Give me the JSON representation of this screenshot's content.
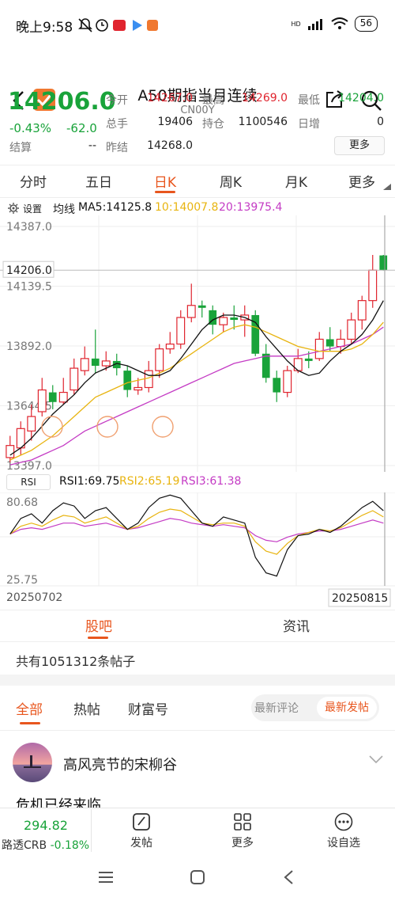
{
  "status_bar": {
    "time": "晚上9:58",
    "battery": "56",
    "hd": "HD"
  },
  "nav": {
    "title": "A50期指当月连续",
    "subtitle": "CN00Y"
  },
  "quote": {
    "price": "14206.0",
    "change_pct": "-0.43%",
    "change": "-62.0",
    "settle_label": "结算",
    "settle_value": "--",
    "open_label": "今开",
    "open_value": "14267.0",
    "high_label": "最高",
    "high_value": "14269.0",
    "low_label": "最低",
    "low_value": "14204.0",
    "volume_label": "总手",
    "volume_value": "19406",
    "oi_label": "持仓",
    "oi_value": "1100546",
    "daily_add_label": "日增",
    "daily_add_value": "0",
    "prev_settle_label": "昨结",
    "prev_settle_value": "14268.0",
    "more_label": "更多"
  },
  "tabs": {
    "intraday": "分时",
    "five_day": "五日",
    "daily_k": "日K",
    "weekly_k": "周K",
    "monthly_k": "月K",
    "more": "更多"
  },
  "chart_header": {
    "settings_label": "设置",
    "ma_label": "均线",
    "ma5": "MA5:14125.8",
    "ma10": "10:14007.8",
    "ma20": "20:13975.4"
  },
  "chart_data": [
    {
      "type": "candlestick",
      "y_ticks": [
        "14387.0",
        "14139.5",
        "13892.0",
        "13644.5",
        "13397.0"
      ],
      "current_price_label": "14206.0",
      "ylim": [
        13397.0,
        14387.0
      ],
      "candles": [
        [
          13430,
          13480,
          13520,
          13410
        ],
        [
          13470,
          13550,
          13580,
          13440
        ],
        [
          13540,
          13600,
          13650,
          13500
        ],
        [
          13620,
          13710,
          13760,
          13600
        ],
        [
          13700,
          13660,
          13730,
          13630
        ],
        [
          13660,
          13700,
          13760,
          13650
        ],
        [
          13710,
          13800,
          13840,
          13690
        ],
        [
          13790,
          13840,
          13890,
          13770
        ],
        [
          13840,
          13810,
          13960,
          13780
        ],
        [
          13810,
          13830,
          13870,
          13790
        ],
        [
          13830,
          13800,
          13860,
          13770
        ],
        [
          13790,
          13710,
          13810,
          13680
        ],
        [
          13710,
          13720,
          13760,
          13690
        ],
        [
          13720,
          13790,
          13830,
          13700
        ],
        [
          13790,
          13880,
          13900,
          13760
        ],
        [
          13880,
          13900,
          13950,
          13860
        ],
        [
          13900,
          14010,
          14040,
          13880
        ],
        [
          14010,
          14060,
          14150,
          13990
        ],
        [
          14060,
          14050,
          14080,
          14010
        ],
        [
          14040,
          13980,
          14060,
          13940
        ],
        [
          13980,
          14010,
          14030,
          13950
        ],
        [
          14010,
          14000,
          14060,
          13960
        ],
        [
          14000,
          14020,
          14060,
          13930
        ],
        [
          14020,
          13860,
          14040,
          13850
        ],
        [
          13860,
          13760,
          13900,
          13740
        ],
        [
          13760,
          13700,
          13790,
          13660
        ],
        [
          13700,
          13790,
          13810,
          13680
        ],
        [
          13790,
          13840,
          13880,
          13780
        ],
        [
          13840,
          13830,
          13870,
          13800
        ],
        [
          13840,
          13920,
          13950,
          13830
        ],
        [
          13920,
          13890,
          13970,
          13870
        ],
        [
          13890,
          13920,
          13960,
          13860
        ],
        [
          13920,
          14000,
          14030,
          13900
        ],
        [
          14000,
          14080,
          14100,
          13960
        ],
        [
          14080,
          14206,
          14269,
          14050
        ],
        [
          14267,
          14206,
          14269,
          14204
        ]
      ],
      "ma5": [
        13440,
        13470,
        13510,
        13560,
        13610,
        13650,
        13690,
        13740,
        13780,
        13800,
        13820,
        13810,
        13790,
        13770,
        13770,
        13790,
        13840,
        13900,
        13960,
        14000,
        14020,
        14020,
        14010,
        13990,
        13930,
        13880,
        13830,
        13790,
        13770,
        13780,
        13830,
        13870,
        13900,
        13940,
        14000,
        14080
      ],
      "ma10": [
        13420,
        13440,
        13460,
        13490,
        13520,
        13560,
        13600,
        13640,
        13680,
        13700,
        13720,
        13740,
        13750,
        13760,
        13780,
        13800,
        13830,
        13860,
        13890,
        13920,
        13950,
        13970,
        13980,
        13970,
        13950,
        13930,
        13910,
        13890,
        13880,
        13870,
        13870,
        13870,
        13880,
        13900,
        13940,
        13990
      ],
      "ma20": [
        13400,
        13410,
        13420,
        13440,
        13460,
        13480,
        13510,
        13540,
        13560,
        13580,
        13600,
        13620,
        13640,
        13660,
        13680,
        13700,
        13720,
        13740,
        13760,
        13780,
        13800,
        13820,
        13830,
        13840,
        13850,
        13850,
        13850,
        13850,
        13860,
        13870,
        13880,
        13890,
        13900,
        13920,
        13940,
        13970
      ]
    },
    {
      "type": "line",
      "rsi_label": "RSI",
      "rsi1": "RSI1:69.75",
      "rsi2": "RSI2:65.19",
      "rsi3": "RSI3:61.38",
      "y_ticks": [
        "80.68",
        "25.75"
      ],
      "ylim": [
        25.75,
        80.68
      ],
      "x_start": "20250702",
      "x_end": "20250815",
      "rsi1_values": [
        55,
        65,
        68,
        62,
        70,
        75,
        73,
        65,
        70,
        72,
        65,
        58,
        62,
        72,
        78,
        80,
        78,
        70,
        62,
        60,
        66,
        64,
        62,
        40,
        30,
        28,
        45,
        54,
        55,
        58,
        56,
        60,
        66,
        72,
        76,
        70
      ],
      "rsi2_values": [
        55,
        60,
        62,
        60,
        64,
        67,
        66,
        62,
        64,
        66,
        62,
        58,
        60,
        65,
        69,
        71,
        70,
        66,
        62,
        61,
        62,
        62,
        60,
        50,
        44,
        42,
        49,
        54,
        56,
        58,
        57,
        59,
        63,
        67,
        70,
        66
      ],
      "rsi3_values": [
        55,
        58,
        59,
        58,
        60,
        62,
        62,
        60,
        61,
        62,
        60,
        58,
        59,
        61,
        63,
        65,
        64,
        62,
        61,
        60,
        61,
        60,
        59,
        54,
        51,
        50,
        53,
        55,
        56,
        57,
        57,
        58,
        60,
        62,
        64,
        62
      ]
    }
  ],
  "section_tabs": {
    "guba": "股吧",
    "news": "资讯"
  },
  "posts_count": "共有1051312条帖子",
  "filters": {
    "all": "全部",
    "hot": "热帖",
    "caifu": "财富号",
    "latest_comment": "最新评论",
    "latest_post": "最新发帖"
  },
  "post": {
    "username": "高风亮节的宋柳谷",
    "title": "危机已经来临"
  },
  "bottom_bar": {
    "ticker_value": "294.82",
    "ticker_name": "路透CRB",
    "ticker_change": "-0.18%",
    "post_label": "发帖",
    "more_label": "更多",
    "watch_label": "设自选"
  },
  "colors": {
    "up": "#e0242e",
    "down": "#19a33a",
    "accent": "#e8561e",
    "ma5": "#111111",
    "ma10": "#e8b410",
    "ma20": "#c43bc4"
  }
}
